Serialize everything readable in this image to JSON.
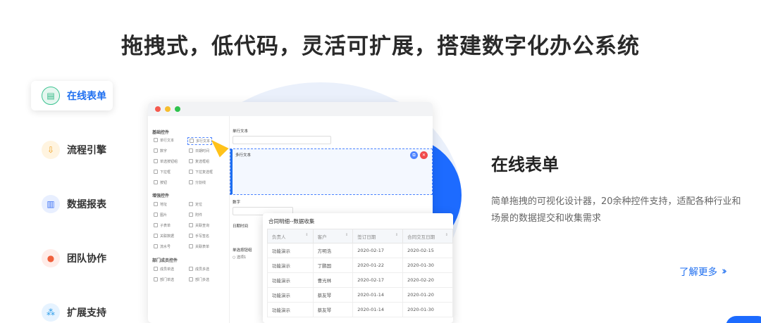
{
  "headline": "拖拽式，低代码，灵活可扩展，搭建数字化办公系统",
  "sidebar": {
    "items": [
      {
        "label": "在线表单",
        "icon": "form-icon",
        "active": true
      },
      {
        "label": "流程引擎",
        "icon": "flow-icon",
        "active": false
      },
      {
        "label": "数据报表",
        "icon": "report-icon",
        "active": false
      },
      {
        "label": "团队协作",
        "icon": "team-icon",
        "active": false
      },
      {
        "label": "扩展支持",
        "icon": "extension-icon",
        "active": false
      }
    ]
  },
  "designer": {
    "groups": [
      "基础控件",
      "增强控件",
      "部门成员控件"
    ],
    "basic_controls": [
      "单行文本",
      "多行文本",
      "数字",
      "日期时间",
      "单选按钮组",
      "复选框组",
      "下拉框",
      "下拉复选框",
      "按钮",
      "分割线"
    ],
    "enhanced_controls": [
      "地址",
      "定位",
      "图片",
      "附件",
      "子表单",
      "关联查询",
      "关联数据",
      "手写签名",
      "流水号",
      "关联表单"
    ],
    "member_controls": [
      "成员单选",
      "成员多选",
      "部门单选",
      "部门多选"
    ],
    "fields": {
      "single_line_label": "单行文本",
      "multi_line_label": "多行文本",
      "number_label": "数字",
      "datetime_label": "日期时间",
      "radio_label": "单选按钮组",
      "radio_option": "选项1"
    }
  },
  "table": {
    "title": "合同明细--数据收集",
    "headers": [
      "负责人",
      "客户",
      "签订日期",
      "合同交互日期"
    ],
    "rows": [
      [
        "功能演示",
        "方明浩",
        "2020-02-17",
        "2020-02-15"
      ],
      [
        "功能演示",
        "丁鹏国",
        "2020-01-22",
        "2020-01-30"
      ],
      [
        "功能演示",
        "曹光林",
        "2020-02-17",
        "2020-02-20"
      ],
      [
        "功能演示",
        "蔡友琴",
        "2020-01-14",
        "2020-01-20"
      ],
      [
        "功能演示",
        "蔡友琴",
        "2020-01-14",
        "2020-01-30"
      ]
    ]
  },
  "feature": {
    "title": "在线表单",
    "description": "简单拖拽的可视化设计器，20余种控件支持，适配各种行业和场景的数据提交和收集需求",
    "more_label": "了解更多"
  },
  "colors": {
    "accent": "#1f6ff0",
    "blob": "#eaf0fb",
    "blue": "#1d6bff",
    "cursor": "#ffc21a"
  }
}
